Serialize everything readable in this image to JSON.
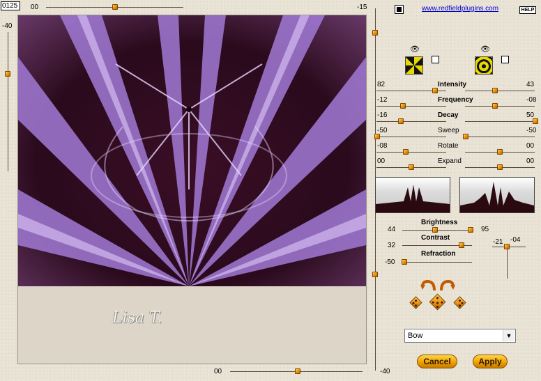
{
  "top": {
    "counter": "0125",
    "slider_left": "00",
    "slider_right": "-15"
  },
  "link": "www.redfieldplugins.com",
  "help": "HELP",
  "left_slider": {
    "value": "-40"
  },
  "bottom": {
    "value": "00"
  },
  "right_v_slider": {
    "value": "-40"
  },
  "params": [
    {
      "label": "Intensity",
      "left": "82",
      "right": "43",
      "bold": true
    },
    {
      "label": "Frequency",
      "left": "-12",
      "right": "-08",
      "bold": true
    },
    {
      "label": "Decay",
      "left": "-16",
      "right": "50",
      "bold": true
    },
    {
      "label": "Sweep",
      "left": "-50",
      "right": "-50",
      "bold": false
    },
    {
      "label": "Rotate",
      "left": "-08",
      "right": "00",
      "bold": false
    },
    {
      "label": "Expand",
      "left": "00",
      "right": "00",
      "bold": false
    }
  ],
  "lighting": {
    "brightness_label": "Brightness",
    "brightness_left": "44",
    "brightness_right": "95",
    "contrast_label": "Contrast",
    "contrast_value": "32",
    "refraction_label": "Refraction",
    "refraction_value": "-50",
    "small_left": "-21",
    "small_right": "-04"
  },
  "preset": {
    "selected": "Bow"
  },
  "buttons": {
    "cancel": "Cancel",
    "apply": "Apply"
  },
  "watermark": "Lisa T.",
  "colors": {
    "accent": "#f09a10",
    "preview_dark": "#2a0a1c",
    "preview_light": "#b58ae8",
    "canvas_bg": "#ddd6c8"
  }
}
